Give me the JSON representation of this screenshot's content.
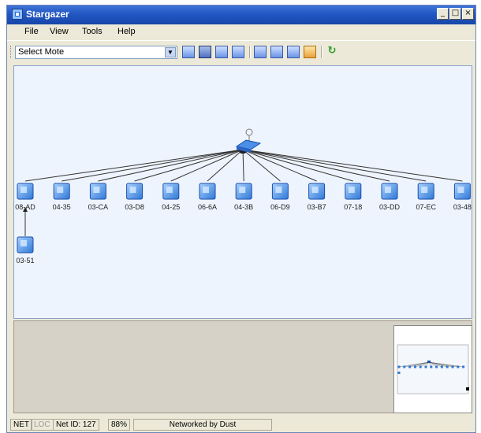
{
  "window": {
    "title": "Stargazer",
    "controls": [
      "minimize",
      "maximize",
      "close"
    ]
  },
  "menu": [
    "File",
    "View",
    "Tools",
    "Help"
  ],
  "toolbar": {
    "mote_select": {
      "value": "Select Mote"
    },
    "buttons": [
      {
        "icon": "mote-info-icon"
      },
      {
        "icon": "network-view-icon",
        "pressed": true
      },
      {
        "icon": "packet-view-icon"
      },
      {
        "icon": "path-view-icon"
      },
      {
        "icon": "zoom-in-icon"
      },
      {
        "icon": "zoom-out-icon"
      },
      {
        "icon": "zoom-fit-icon"
      },
      {
        "icon": "actual-size-icon"
      },
      {
        "icon": "refresh-icon"
      }
    ]
  },
  "network": {
    "manager": {
      "icon": "access-point-icon"
    },
    "motes": [
      "08-AD",
      "04-35",
      "03-CA",
      "03-D8",
      "04-25",
      "06-6A",
      "04-3B",
      "06-D9",
      "03-B7",
      "07-18",
      "03-DD",
      "07-EC",
      "03-48"
    ],
    "child_motes": [
      {
        "label": "03-51",
        "parent": "08-AD"
      }
    ]
  },
  "status": {
    "net": "NET",
    "loc": "LOC",
    "net_id": "Net ID: 127",
    "percent": "88%",
    "message": "Networked by Dust"
  }
}
